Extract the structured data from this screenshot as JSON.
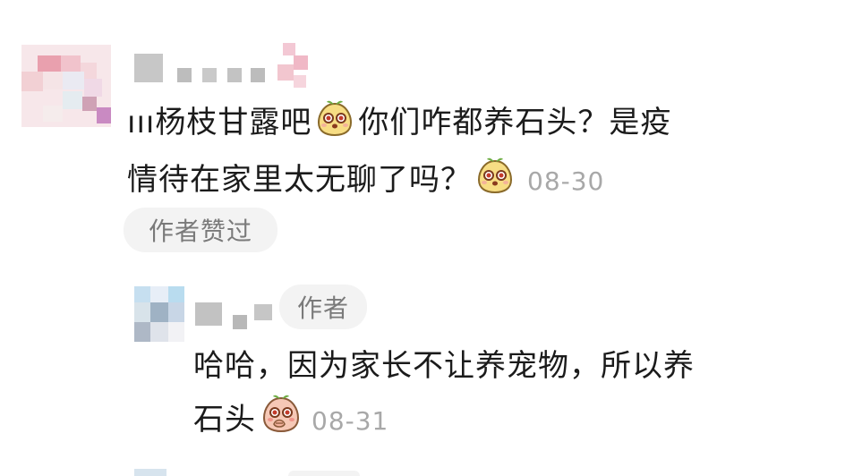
{
  "comment": {
    "username_visible": "",
    "line1_prefix": "ııı杨枝甘露吧",
    "line1_suffix": "你们咋都养石头？是疫",
    "line2": "情待在家里太无聊了吗？",
    "time": "08-30",
    "author_liked_label": "作者赞过"
  },
  "reply": {
    "author_badge": "作者",
    "line1": "哈哈，因为家长不让养宠物，所以养",
    "line2_text": "石头",
    "time": "08-31"
  },
  "icons": {
    "emoji_1": "smiling-potato-emoji",
    "emoji_2": "smiling-potato-emoji",
    "emoji_3": "giggling-potato-emoji"
  },
  "colors": {
    "text": "#1b1b1b",
    "muted": "#a8a8a8",
    "pill_bg": "#f3f3f3"
  }
}
